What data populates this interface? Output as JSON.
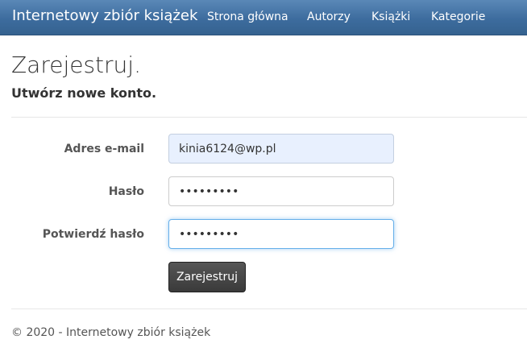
{
  "navbar": {
    "brand": "Internetowy zbiór książek",
    "links": [
      "Strona główna",
      "Autorzy",
      "Książki",
      "Kategorie"
    ]
  },
  "page": {
    "title": "Zarejestruj.",
    "subtitle": "Utwórz nowe konto."
  },
  "form": {
    "email": {
      "label": "Adres e-mail",
      "value": "kinia6124@wp.pl"
    },
    "password": {
      "label": "Hasło",
      "value": "password1"
    },
    "confirm_password": {
      "label": "Potwierdź hasło",
      "value": "password1"
    },
    "submit_label": "Zarejestruj"
  },
  "footer": {
    "text": "© 2020 - Internetowy zbiór książek"
  },
  "colors": {
    "navbar": "#3d6c9e",
    "autofill": "#e8f0fe",
    "focus": "#66afe9",
    "button": "#444444"
  }
}
